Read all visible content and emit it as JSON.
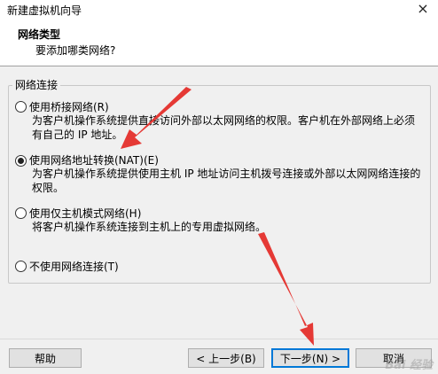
{
  "window": {
    "title": "新建虚拟机向导",
    "close_glyph": "×"
  },
  "header": {
    "title": "网络类型",
    "subtitle": "要添加哪类网络?"
  },
  "group": {
    "label": "网络连接"
  },
  "options": [
    {
      "label": "使用桥接网络(R)",
      "desc": "为客户机操作系统提供直接访问外部以太网网络的权限。客户机在外部网络上必须有自己的 IP 地址。",
      "checked": false
    },
    {
      "label": "使用网络地址转换(NAT)(E)",
      "desc": "为客户机操作系统提供使用主机 IP 地址访问主机拨号连接或外部以太网网络连接的权限。",
      "checked": true
    },
    {
      "label": "使用仅主机模式网络(H)",
      "desc": "将客户机操作系统连接到主机上的专用虚拟网络。",
      "checked": false
    },
    {
      "label": "不使用网络连接(T)",
      "desc": "",
      "checked": false
    }
  ],
  "buttons": {
    "help": "帮助",
    "back": "< 上一步(B)",
    "next": "下一步(N) >",
    "cancel": "取消"
  },
  "annotation_color": "#e53935",
  "watermark": "Bai 经验"
}
